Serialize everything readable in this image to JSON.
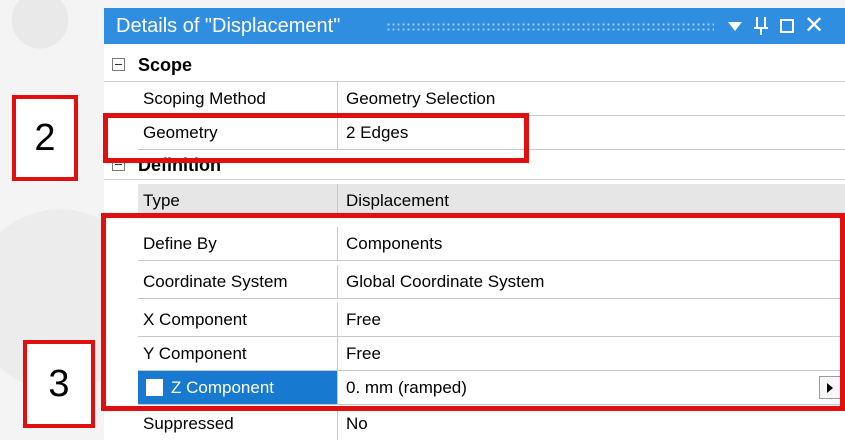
{
  "window": {
    "title": "Details of \"Displacement\"",
    "icons": [
      "dropdown-arrow-icon",
      "pin-icon",
      "maximize-icon",
      "close-icon"
    ],
    "close_glyph": "✕"
  },
  "groups": {
    "scope": {
      "label": "Scope"
    },
    "definition": {
      "label": "Definition"
    }
  },
  "rows": {
    "scoping_method": {
      "label": "Scoping Method",
      "value": "Geometry Selection"
    },
    "geometry": {
      "label": "Geometry",
      "value": "2 Edges"
    },
    "type": {
      "label": "Type",
      "value": "Displacement"
    },
    "define_by": {
      "label": "Define By",
      "value": "Components"
    },
    "coord_sys": {
      "label": "Coordinate System",
      "value": "Global Coordinate System"
    },
    "x_comp": {
      "label": "X Component",
      "value": "Free"
    },
    "y_comp": {
      "label": "Y Component",
      "value": "Free"
    },
    "z_comp": {
      "label": "Z Component",
      "value": "0. mm  (ramped)"
    },
    "suppressed": {
      "label": "Suppressed",
      "value": "No"
    }
  },
  "callouts": {
    "two": "2",
    "three": "3"
  },
  "colors": {
    "titlebar": "#2f8ee0",
    "selected": "#1779d0",
    "callout": "#e01010"
  }
}
